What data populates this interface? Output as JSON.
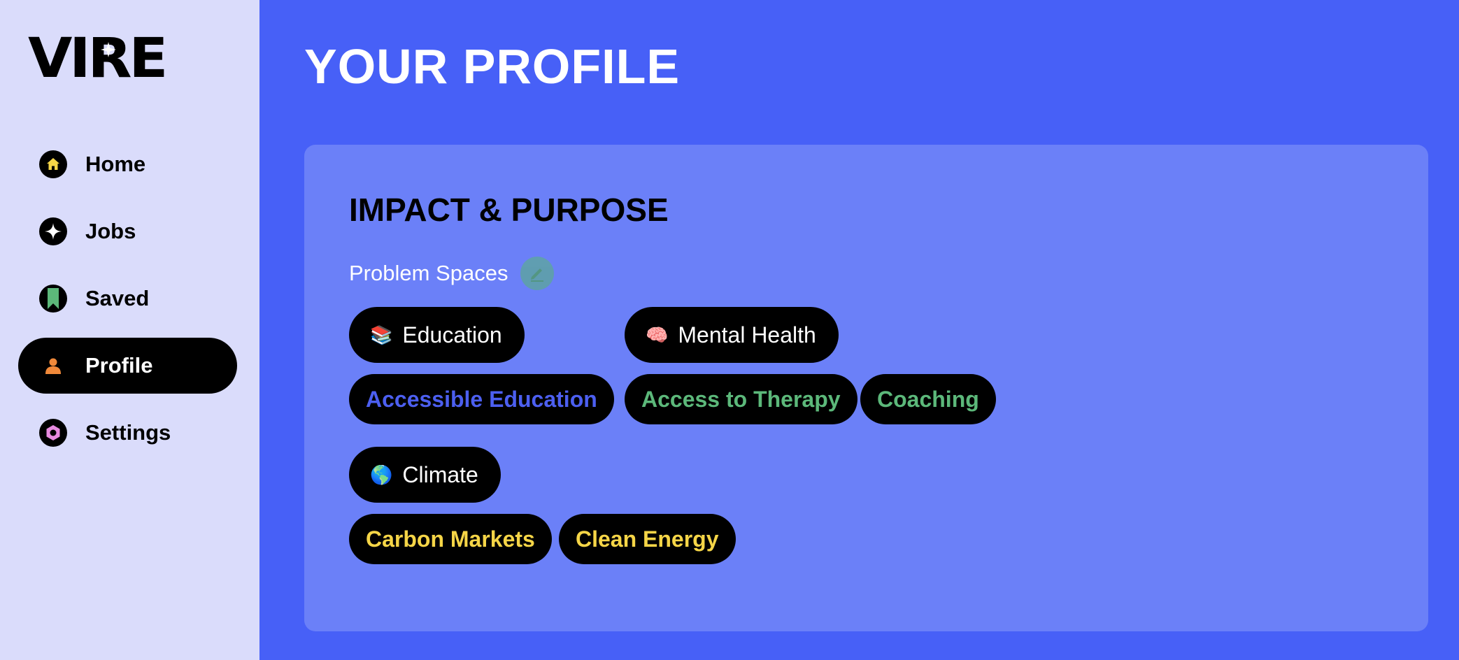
{
  "logo": {
    "text": "VIRE"
  },
  "sidebar": {
    "items": [
      {
        "label": "Home",
        "icon": "home-icon",
        "icon_color": "#f5d547"
      },
      {
        "label": "Jobs",
        "icon": "sparkle-icon",
        "icon_color": "#ffffff"
      },
      {
        "label": "Saved",
        "icon": "bookmark-icon",
        "icon_color": "#5cb87a"
      },
      {
        "label": "Profile",
        "icon": "person-icon",
        "icon_color": "#f0893a",
        "active": true
      },
      {
        "label": "Settings",
        "icon": "gear-icon",
        "icon_color": "#e88be0"
      }
    ]
  },
  "main": {
    "title": "YOUR PROFILE",
    "card": {
      "title": "IMPACT & PURPOSE",
      "section_label": "Problem Spaces",
      "problem_spaces": [
        {
          "label": "Education",
          "emoji": "📚",
          "color": "#4c5ff0",
          "subtopics": [
            "Accessible Education"
          ]
        },
        {
          "label": "Mental Health",
          "emoji": "🧠",
          "color": "#5cb87a",
          "subtopics": [
            "Access to Therapy",
            "Coaching"
          ]
        },
        {
          "label": "Climate",
          "emoji": "🌎",
          "color": "#f5d547",
          "subtopics": [
            "Carbon Markets",
            "Clean Energy"
          ]
        }
      ]
    }
  },
  "colors": {
    "background": "#4760f7",
    "sidebar": "#dadcfb",
    "card": "#6b80f8",
    "edit_button": "#5ea3a4"
  }
}
